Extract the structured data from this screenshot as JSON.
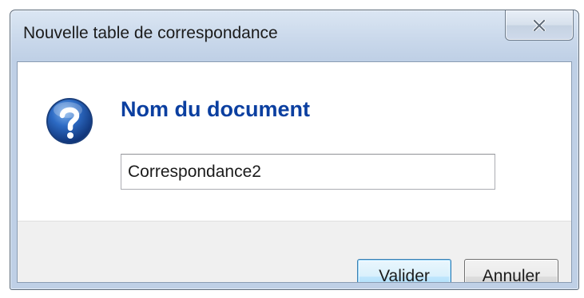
{
  "window": {
    "title": "Nouvelle table de correspondance",
    "close_icon": "close-icon"
  },
  "content": {
    "icon": "question-icon",
    "main_instruction": "Nom du document",
    "name_field": {
      "value": "Correspondance2",
      "placeholder": ""
    }
  },
  "buttons": {
    "ok_label": "Valider",
    "cancel_label": "Annuler"
  },
  "colors": {
    "instruction_text": "#0b3fa0",
    "default_button_border": "#3c7fb1",
    "footer_background": "#f0f0f0"
  }
}
